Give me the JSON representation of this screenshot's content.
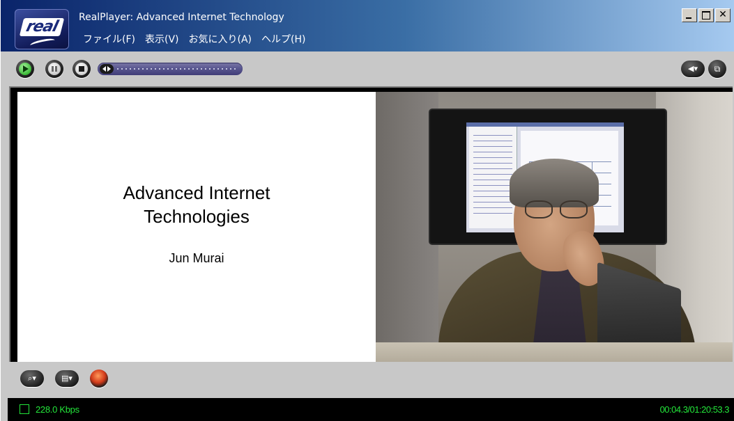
{
  "window": {
    "title": "RealPlayer: Advanced Internet Technology",
    "logo_text": "real",
    "controls": {
      "minimize": "minimize",
      "maximize": "maximize",
      "close": "✕"
    }
  },
  "menu": {
    "items": [
      "ファイル(F)",
      "表示(V)",
      "お気に入り(A)",
      "ヘルプ(H)"
    ]
  },
  "toolbar": {
    "buttons": [
      "play-icon",
      "pause-icon",
      "stop-icon"
    ],
    "seek_position": 0,
    "right_buttons": [
      "volume-icon",
      "compact-mode-icon"
    ]
  },
  "slide": {
    "title_line1": "Advanced Internet",
    "title_line2": "Technologies",
    "author": "Jun Murai"
  },
  "video": {
    "content": "lecturer-video"
  },
  "bottom_toolbar": {
    "buttons": [
      "zoom-icon",
      "video-options-icon",
      "real-network-icon"
    ]
  },
  "status": {
    "bitrate": "228.0 Kbps",
    "time": "00:04.3/01:20:53.3",
    "color": "#23e63a"
  }
}
